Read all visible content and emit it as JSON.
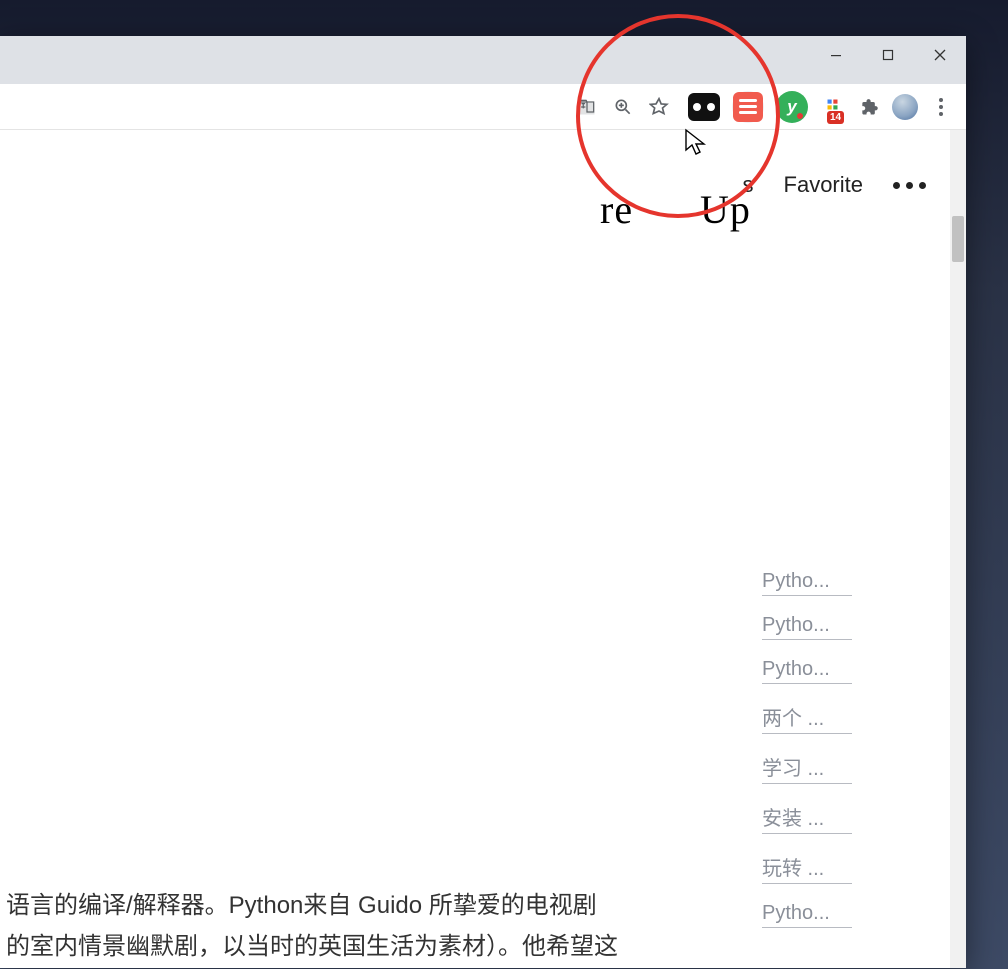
{
  "window": {
    "minimize_tooltip": "Minimize",
    "maximize_tooltip": "Maximize",
    "close_tooltip": "Close"
  },
  "toolbar": {
    "translate_tooltip": "Translate",
    "zoom_tooltip": "Zoom",
    "bookmark_tooltip": "Bookmark this tab",
    "apps_badge": "14",
    "extensions_tooltip": "Extensions",
    "menu_tooltip": "Customize and control"
  },
  "extensions": {
    "item1_name": "camera-binoculars-icon",
    "item2_name": "reader-icon",
    "item3_name": "y-extension-icon",
    "item3_glyph": "y"
  },
  "page": {
    "nav": {
      "partial_text_1": "re",
      "partial_text_2": "Up",
      "partial_right_char": "s",
      "favorite": "Favorite"
    },
    "toc": [
      "Pytho...",
      "Pytho...",
      "Pytho...",
      "两个 ...",
      "学习 ...",
      "安装 ...",
      "玩转 ...",
      "Pytho..."
    ],
    "body_line1": "语言的编译/解释器。Python来自 Guido 所挚爱的电视剧",
    "body_line2": "的室内情景幽默剧，以当时的英国生活为素材）。他希望这"
  }
}
